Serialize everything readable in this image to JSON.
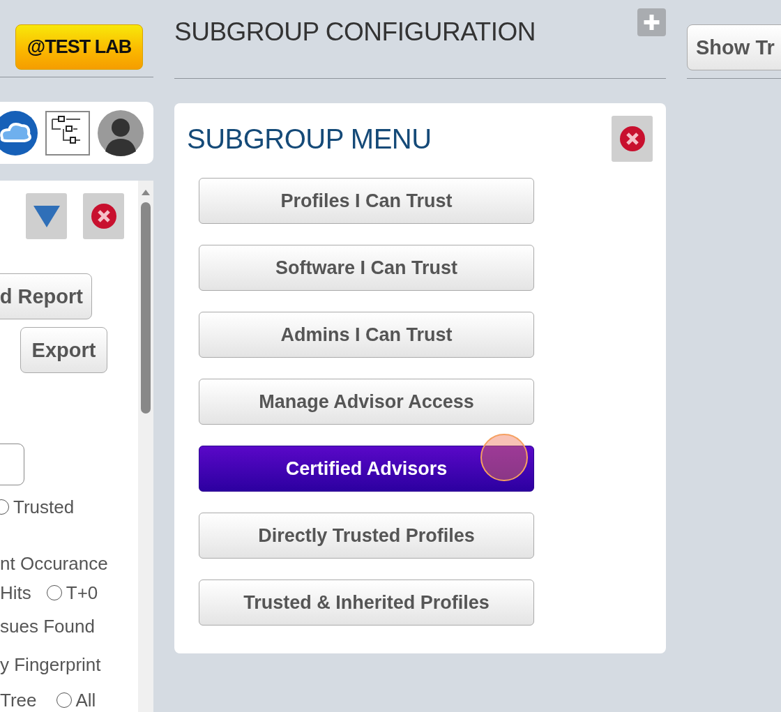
{
  "header": {
    "badge": "@TEST LAB",
    "title": "SUBGROUP CONFIGURATION",
    "show_button": "Show Tr"
  },
  "left_panel": {
    "report_button": "d Report",
    "export_button": "Export",
    "lines": [
      [
        {
          "kind": "radio",
          "label": "Trusted",
          "selected": false
        }
      ],
      [
        {
          "kind": "text",
          "label": "nt Occurance"
        }
      ],
      [
        {
          "kind": "text",
          "label": "Hits"
        },
        {
          "kind": "radio",
          "label": "T+0",
          "selected": false
        }
      ],
      [
        {
          "kind": "text",
          "label": "sues Found"
        }
      ],
      [
        {
          "kind": "text",
          "label": "y Fingerprint"
        }
      ],
      [
        {
          "kind": "text",
          "label": "Tree"
        },
        {
          "kind": "radio",
          "label": "All",
          "selected": false
        }
      ]
    ]
  },
  "subgroup_menu": {
    "title": "SUBGROUP MENU",
    "items": [
      {
        "label": "Profiles I Can Trust",
        "selected": false
      },
      {
        "label": "Software I Can Trust",
        "selected": false
      },
      {
        "label": "Admins I Can Trust",
        "selected": false
      },
      {
        "label": "Manage Advisor Access",
        "selected": false
      },
      {
        "label": "Certified Advisors",
        "selected": true
      },
      {
        "label": "Directly Trusted Profiles",
        "selected": false
      },
      {
        "label": "Trusted & Inherited Profiles",
        "selected": false
      }
    ]
  }
}
